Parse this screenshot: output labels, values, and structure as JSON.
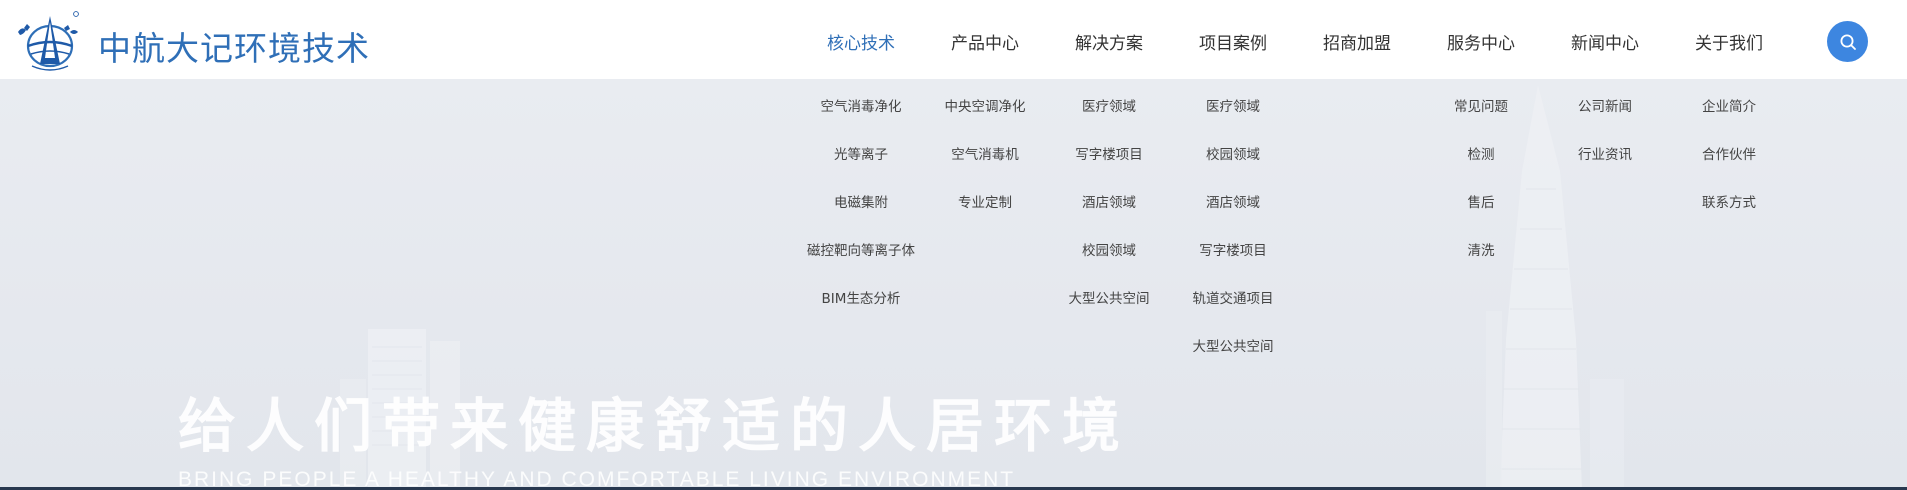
{
  "brand": {
    "name": "中航大记环境技术"
  },
  "nav": {
    "items": [
      {
        "label": "核心技术",
        "active": true
      },
      {
        "label": "产品中心",
        "active": false
      },
      {
        "label": "解决方案",
        "active": false
      },
      {
        "label": "项目案例",
        "active": false
      },
      {
        "label": "招商加盟",
        "active": false
      },
      {
        "label": "服务中心",
        "active": false
      },
      {
        "label": "新闻中心",
        "active": false
      },
      {
        "label": "关于我们",
        "active": false
      }
    ]
  },
  "search": {
    "icon": "search-icon"
  },
  "dropdown": {
    "columns": [
      {
        "links": [
          "空气消毒净化",
          "光等离子",
          "电磁集附",
          "磁控靶向等离子体",
          "BIM生态分析"
        ]
      },
      {
        "links": [
          "中央空调净化",
          "空气消毒机",
          "专业定制"
        ]
      },
      {
        "links": [
          "医疗领域",
          "写字楼项目",
          "酒店领域",
          "校园领域",
          "大型公共空间"
        ]
      },
      {
        "links": [
          "医疗领域",
          "校园领域",
          "酒店领域",
          "写字楼项目",
          "轨道交通项目",
          "大型公共空间"
        ]
      },
      {
        "links": []
      },
      {
        "links": [
          "常见问题",
          "检测",
          "售后",
          "清洗"
        ]
      },
      {
        "links": [
          "公司新闻",
          "行业资讯"
        ]
      },
      {
        "links": [
          "企业简介",
          "合作伙伴",
          "联系方式"
        ]
      }
    ]
  },
  "hero": {
    "headline": "给人们带来健康舒适的人居环境",
    "subline": "BRING PEOPLE A HEALTHY AND COMFORTABLE LIVING ENVIRONMENT"
  },
  "colors": {
    "brand": "#2f6fb7",
    "accent": "#3d86e0",
    "text": "#333333"
  }
}
